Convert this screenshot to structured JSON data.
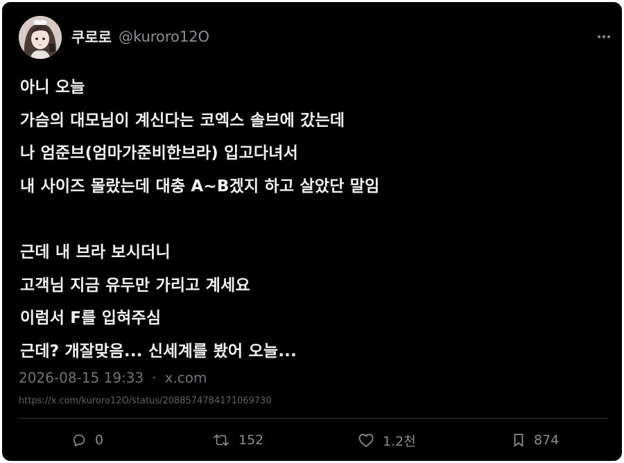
{
  "tweet": {
    "display_name": "쿠로로",
    "handle": "@kuroro12O",
    "lines": [
      "아니 오늘",
      "가슴의 대모님이 계신다는 코엑스 솔브에 갔는데",
      "나 엄준브(엄마가준비한브라) 입고다녀서",
      "내 사이즈 몰랐는데 대충 A~B겠지 하고 살았단 말임",
      "",
      "근데 내 브라 보시더니",
      "고객님 지금 유두만 가리고 계세요",
      "이럼서 F를 입혀주심",
      "근데? 개잘맞음... 신세계를 봤어 오늘..."
    ],
    "timestamp": "2026-08-15 19:33",
    "separator": "·",
    "source": "x.com",
    "url": "https://x.com/kuroro12O/status/2088574784171069730"
  },
  "actions": {
    "reply_count": "0",
    "retweet_count": "152",
    "like_count": "1.2천",
    "bookmark_count": "874"
  },
  "icons": {
    "more": "more-horizontal-icon",
    "reply": "reply-icon",
    "retweet": "retweet-icon",
    "like": "heart-icon",
    "bookmark": "bookmark-icon"
  },
  "colors": {
    "background": "#000000",
    "text": "#f2f2f2",
    "muted": "#8b8f94"
  }
}
